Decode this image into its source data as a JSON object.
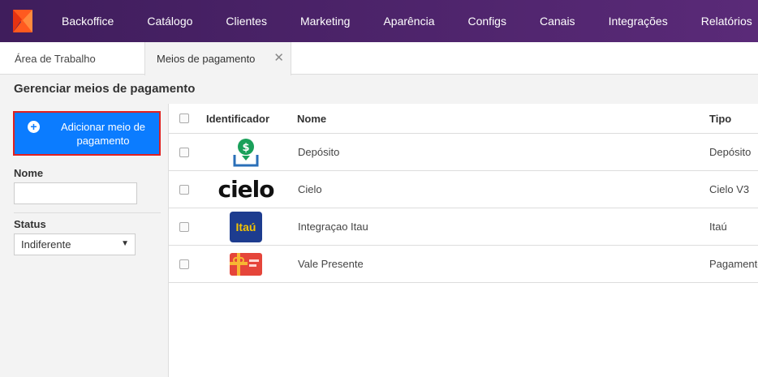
{
  "nav": {
    "items": [
      "Backoffice",
      "Catálogo",
      "Clientes",
      "Marketing",
      "Aparência",
      "Configs",
      "Canais",
      "Integrações",
      "Relatórios"
    ]
  },
  "tabs": {
    "home": "Área de Trabalho",
    "active": "Meios de pagamento",
    "close": "✕"
  },
  "page": {
    "title": "Gerenciar meios de pagamento"
  },
  "sidebar": {
    "add_button": "Adicionar meio de pagamento",
    "name_label": "Nome",
    "name_value": "",
    "status_label": "Status",
    "status_value": "Indiferente"
  },
  "table": {
    "headers": {
      "identifier": "Identificador",
      "name": "Nome",
      "type": "Tipo"
    },
    "rows": [
      {
        "logo": "deposit-icon",
        "name": "Depósito",
        "type": "Depósito"
      },
      {
        "logo": "cielo",
        "logo_text": "cielo",
        "name": "Cielo",
        "type": "Cielo V3"
      },
      {
        "logo": "itau",
        "logo_text": "Itaú",
        "name": "Integraçao Itau",
        "type": "Itaú"
      },
      {
        "logo": "gift-card-icon",
        "name": "Vale Presente",
        "type": "Pagamento"
      }
    ]
  },
  "colors": {
    "nav_bg": "#4a2468",
    "primary_button": "#0b7cff",
    "highlight_border": "#e02020",
    "deposit_green": "#1aa05a",
    "itau_blue": "#1d3c8f",
    "itau_yellow": "#f5c400",
    "gift_red": "#e5453a"
  }
}
